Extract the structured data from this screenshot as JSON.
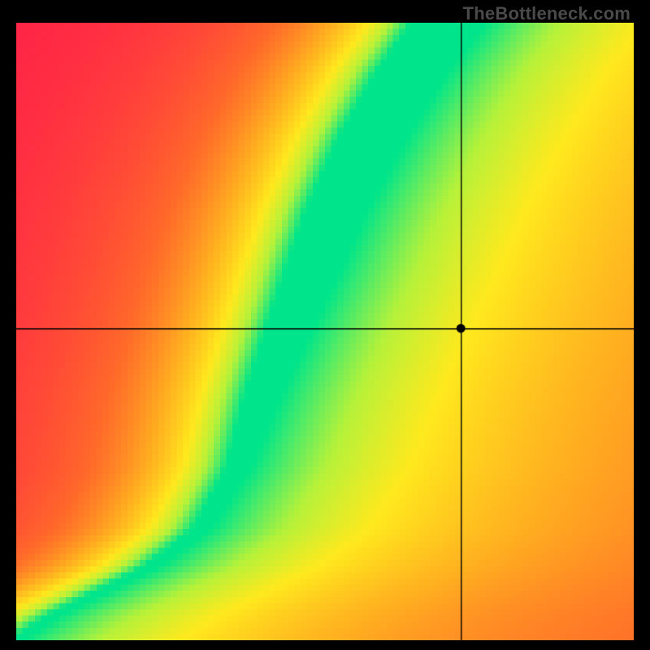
{
  "watermark": "TheBottleneck.com",
  "chart_data": {
    "type": "heatmap",
    "title": "",
    "xlabel": "",
    "ylabel": "",
    "xlim": [
      0,
      1
    ],
    "ylim": [
      0,
      1
    ],
    "grid_resolution": 100,
    "crosshair": {
      "x": 0.72,
      "y": 0.505
    },
    "marker": {
      "x": 0.72,
      "y": 0.505
    },
    "color_scale": [
      {
        "t": 0.0,
        "color": "#ff1a4b"
      },
      {
        "t": 0.35,
        "color": "#ff6a2a"
      },
      {
        "t": 0.55,
        "color": "#ffb020"
      },
      {
        "t": 0.72,
        "color": "#ffe91e"
      },
      {
        "t": 0.85,
        "color": "#b6f23a"
      },
      {
        "t": 1.0,
        "color": "#00e58b"
      }
    ],
    "ridge": {
      "description": "Piecewise-linear optimal-GPU-vs-CPU ridge; points are (x, y) in [0,1] with y measured from the bottom of the plot.",
      "points": [
        [
          0.0,
          0.0
        ],
        [
          0.06,
          0.04
        ],
        [
          0.14,
          0.08
        ],
        [
          0.22,
          0.12
        ],
        [
          0.3,
          0.18
        ],
        [
          0.36,
          0.28
        ],
        [
          0.4,
          0.4
        ],
        [
          0.46,
          0.55
        ],
        [
          0.52,
          0.7
        ],
        [
          0.58,
          0.82
        ],
        [
          0.64,
          0.92
        ],
        [
          0.7,
          1.0
        ]
      ],
      "width_profile": [
        [
          0.0,
          0.01
        ],
        [
          0.1,
          0.012
        ],
        [
          0.25,
          0.018
        ],
        [
          0.4,
          0.03
        ],
        [
          0.6,
          0.045
        ],
        [
          0.8,
          0.055
        ],
        [
          1.0,
          0.06
        ]
      ]
    },
    "background_gradient": {
      "left_side": "red",
      "right_of_ridge": "orange_to_yellow",
      "note": "Score decreases with horizontal distance from ridge; decay is slower on the right side than the left."
    }
  }
}
